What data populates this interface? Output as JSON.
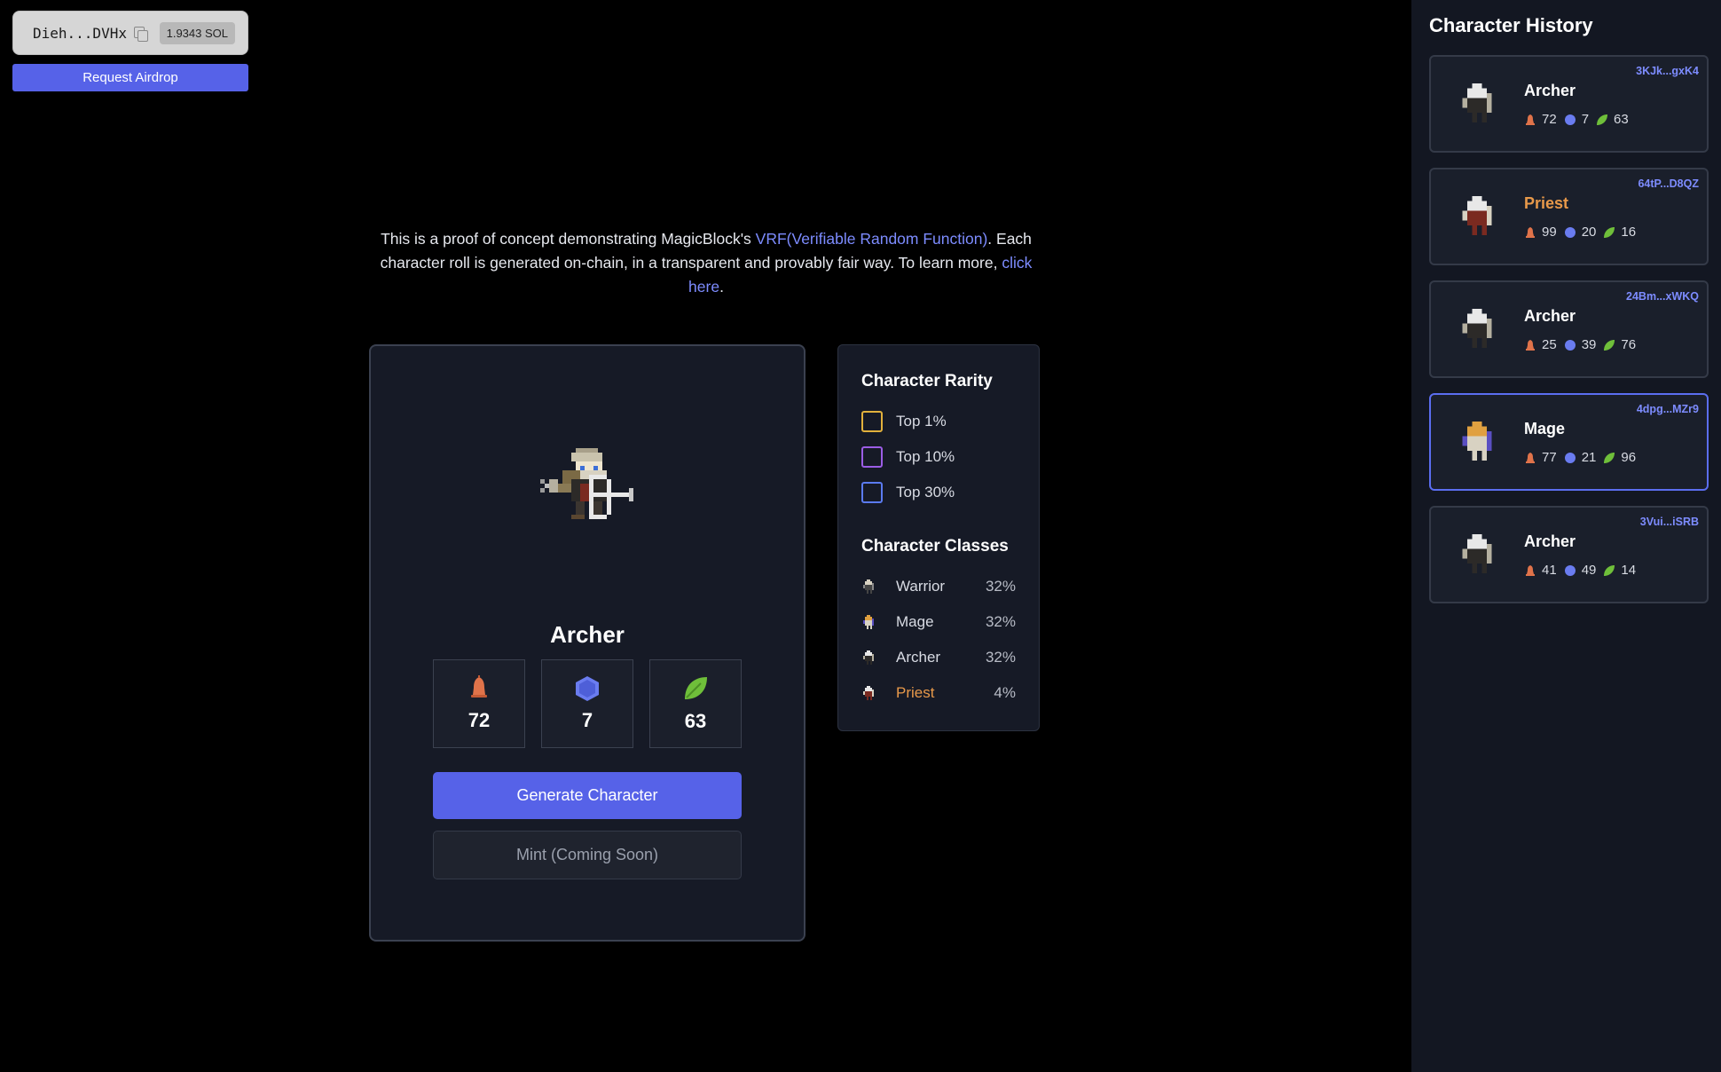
{
  "wallet": {
    "address": "Dieh...DVHx",
    "balance": "1.9343 SOL",
    "airdrop_label": "Request Airdrop"
  },
  "intro": {
    "part1": "This is a proof of concept demonstrating MagicBlock's ",
    "vrf_link": "VRF(Verifiable Random Function)",
    "part2": ". Each character roll is generated on-chain, in a transparent and provably fair way. To learn more, ",
    "more_link": "click here",
    "part3": "."
  },
  "character": {
    "name": "Archer",
    "stats": {
      "attack": "72",
      "defense": "7",
      "nature": "63"
    },
    "generate_label": "Generate Character",
    "mint_label": "Mint (Coming Soon)"
  },
  "rarity": {
    "title": "Character Rarity",
    "tiers": [
      {
        "label": "Top 1%",
        "color": "#e2b13c"
      },
      {
        "label": "Top 10%",
        "color": "#9b5de5"
      },
      {
        "label": "Top 30%",
        "color": "#5b7bf0"
      }
    ]
  },
  "classes": {
    "title": "Character Classes",
    "items": [
      {
        "name": "Warrior",
        "pct": "32%"
      },
      {
        "name": "Mage",
        "pct": "32%"
      },
      {
        "name": "Archer",
        "pct": "32%"
      },
      {
        "name": "Priest",
        "pct": "4%"
      }
    ]
  },
  "history": {
    "title": "Character History",
    "items": [
      {
        "id": "3KJk...gxK4",
        "name": "Archer",
        "attack": "72",
        "defense": "7",
        "nature": "63"
      },
      {
        "id": "64tP...D8QZ",
        "name": "Priest",
        "attack": "99",
        "defense": "20",
        "nature": "16"
      },
      {
        "id": "24Bm...xWKQ",
        "name": "Archer",
        "attack": "25",
        "defense": "39",
        "nature": "76"
      },
      {
        "id": "4dpg...MZr9",
        "name": "Mage",
        "attack": "77",
        "defense": "21",
        "nature": "96"
      },
      {
        "id": "3Vui...iSRB",
        "name": "Archer",
        "attack": "41",
        "defense": "49",
        "nature": "14"
      }
    ]
  },
  "colors": {
    "accent": "#5662e8",
    "link": "#7d8cff",
    "priest": "#e8994a",
    "attack": "#e0734a",
    "defense": "#6a7cf0",
    "nature": "#6fbf3a"
  },
  "icons": {
    "attack": "bell-icon",
    "defense": "hexagon-gem-icon",
    "nature": "leaf-icon"
  }
}
